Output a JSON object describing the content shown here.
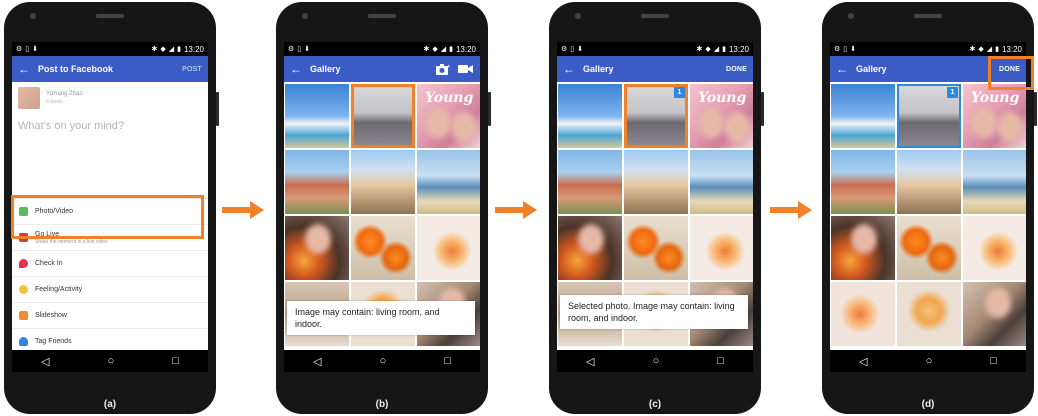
{
  "panels": {
    "a": {
      "label": "(a)",
      "status_time": "13:20",
      "appbar": {
        "title": "Post to Facebook",
        "action": "POST"
      },
      "user": {
        "name": "Yizhang Zhao",
        "sub": "Friends"
      },
      "placeholder": "What's on your mind?",
      "menu": [
        {
          "label": "Photo/Video",
          "sub": "",
          "icon": "photo-icon",
          "color": "#5cb85c"
        },
        {
          "label": "Go Live",
          "sub": "Share the moment in a live video",
          "icon": "live-video-icon",
          "color": "#e0344b"
        },
        {
          "label": "Check In",
          "sub": "",
          "icon": "location-pin-icon",
          "color": "#e0344b"
        },
        {
          "label": "Feeling/Activity",
          "sub": "",
          "icon": "smiley-icon",
          "color": "#f5c33b"
        },
        {
          "label": "Slideshow",
          "sub": "",
          "icon": "slideshow-icon",
          "color": "#f28a2e"
        },
        {
          "label": "Tag Friends",
          "sub": "",
          "icon": "tag-friends-icon",
          "color": "#3b82e0"
        }
      ]
    },
    "b": {
      "label": "(b)",
      "status_time": "13:20",
      "appbar": {
        "title": "Gallery"
      },
      "tooltip": "Image may contain: living room, and indoor."
    },
    "c": {
      "label": "(c)",
      "status_time": "13:20",
      "appbar": {
        "title": "Gallery",
        "action": "DONE"
      },
      "badge": "1",
      "tooltip": "Selected photo. Image may contain: living room, and indoor."
    },
    "d": {
      "label": "(d)",
      "status_time": "13:20",
      "appbar": {
        "title": "Gallery",
        "action": "DONE"
      },
      "badge": "1"
    }
  },
  "young_text": "Young",
  "colors": {
    "appbar": "#3b5cc4",
    "highlight": "#f0802a",
    "select_badge": "#2b8ae0"
  }
}
